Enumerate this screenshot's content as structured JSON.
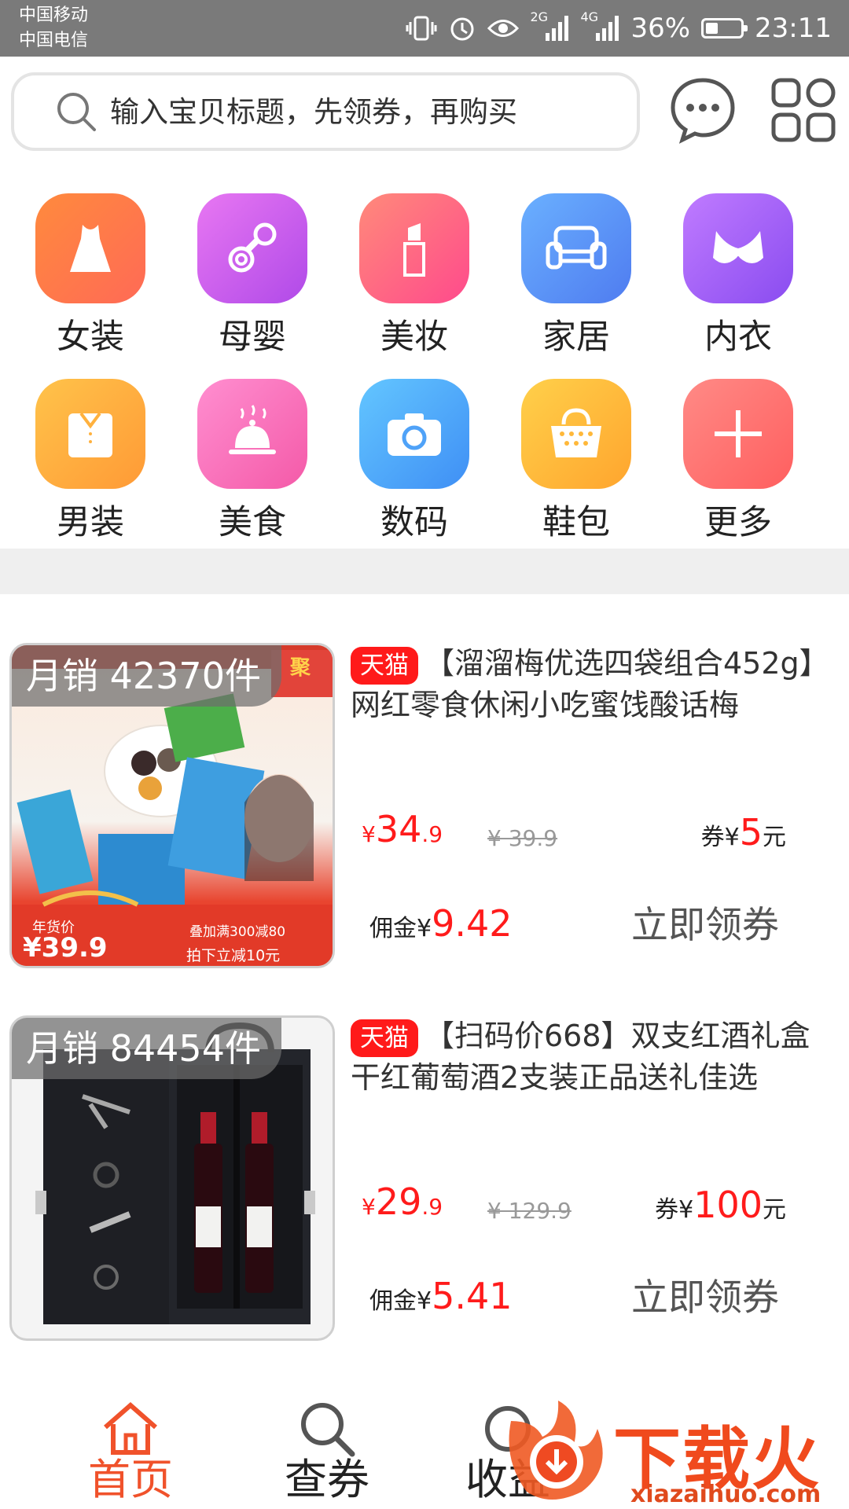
{
  "status_bar": {
    "carrier1": "中国移动",
    "carrier2": "中国电信",
    "net1": "2G",
    "net2": "4G",
    "battery_text": "36%",
    "battery_level": 0.36,
    "time": "23:11"
  },
  "search": {
    "placeholder": "输入宝贝标题，先领券，再购买"
  },
  "header": {
    "message_icon": "chat-bubble-icon",
    "grid_icon": "apps-grid-icon"
  },
  "categories": [
    {
      "label": "女装",
      "icon": "dress-icon",
      "color1": "#ff8a3d",
      "color2": "#ff6a56"
    },
    {
      "label": "母婴",
      "icon": "pacifier-icon",
      "color1": "#e877f2",
      "color2": "#b04ae8"
    },
    {
      "label": "美妆",
      "icon": "lipstick-icon",
      "color1": "#ff8a7a",
      "color2": "#ff4a8c"
    },
    {
      "label": "家居",
      "icon": "sofa-icon",
      "color1": "#6ab0ff",
      "color2": "#4f7cf0"
    },
    {
      "label": "内衣",
      "icon": "bra-icon",
      "color1": "#c07bff",
      "color2": "#8a4cf0"
    },
    {
      "label": "男装",
      "icon": "shirt-icon",
      "color1": "#ffc34a",
      "color2": "#ff9a36"
    },
    {
      "label": "美食",
      "icon": "food-cloche-icon",
      "color1": "#ff8ed0",
      "color2": "#f45aa8"
    },
    {
      "label": "数码",
      "icon": "camera-icon",
      "color1": "#63c6ff",
      "color2": "#3f8ff5"
    },
    {
      "label": "鞋包",
      "icon": "handbag-icon",
      "color1": "#ffd04a",
      "color2": "#ffa52e"
    },
    {
      "label": "更多",
      "icon": "plus-icon",
      "color1": "#ff8a86",
      "color2": "#ff5f5f"
    }
  ],
  "products": [
    {
      "sales": "月销 42370件",
      "badge": "天猫",
      "title": "【溜溜梅优选四袋组合452g】网红零食休闲小吃蜜饯酸话梅",
      "price_symbol": "¥",
      "price_int": "34",
      "price_dec": ".9",
      "orig_price": "¥ 39.9",
      "coupon_label": "券¥",
      "coupon_value": "5",
      "coupon_unit": "元",
      "commission_label": "佣金¥",
      "commission_value": "9.42",
      "claim_label": "立即领券",
      "img_texts": {
        "promo1": "年货价",
        "promo_price": "¥39.9",
        "promo2": "叠加满300减80",
        "promo3": "拍下立减10元",
        "brand": "聚"
      }
    },
    {
      "sales": "月销 84454件",
      "badge": "天猫",
      "title": "【扫码价668】双支红酒礼盒干红葡萄酒2支装正品送礼佳选",
      "price_symbol": "¥",
      "price_int": "29",
      "price_dec": ".9",
      "orig_price": "¥ 129.9",
      "coupon_label": "券¥",
      "coupon_value": "100",
      "coupon_unit": "元",
      "commission_label": "佣金¥",
      "commission_value": "5.41",
      "claim_label": "立即领券"
    }
  ],
  "bottom_nav": [
    {
      "label": "首页",
      "icon": "home-icon",
      "active": true
    },
    {
      "label": "查券",
      "icon": "search-icon",
      "active": false
    },
    {
      "label": "收益",
      "icon": "income-icon",
      "active": false
    }
  ],
  "watermark": {
    "text": "下载火",
    "url": "xiazaihuo.com"
  },
  "colors": {
    "accent": "#ff1b1b",
    "nav_active": "#f0522b",
    "status_bar": "#7a7a7a"
  }
}
